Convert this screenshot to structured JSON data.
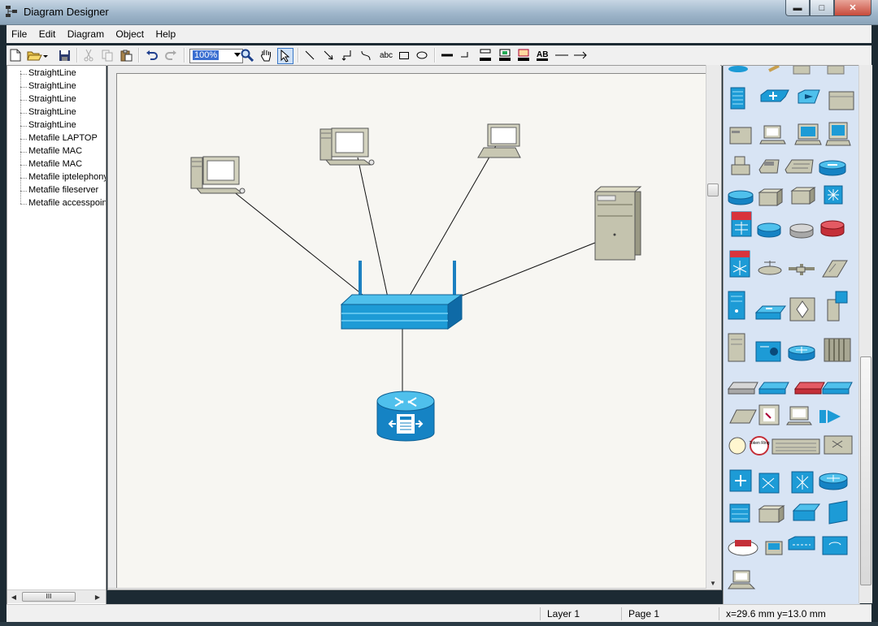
{
  "window": {
    "title": "Diagram Designer",
    "minimize": "▬",
    "maximize": "□",
    "close": "✕"
  },
  "menu": [
    "File",
    "Edit",
    "Diagram",
    "Object",
    "Help"
  ],
  "toolbar": {
    "zoom_value": "100%",
    "text_tool_label": "abc"
  },
  "tree": {
    "items": [
      "StraightLine",
      "StraightLine",
      "StraightLine",
      "StraightLine",
      "StraightLine",
      "Metafile LAPTOP",
      "Metafile MAC",
      "Metafile MAC",
      "Metafile iptelephony",
      "Metafile fileserver",
      "Metafile accesspoint"
    ],
    "scroll_thumb_label": "III"
  },
  "palette": {
    "token_ring_label": "Token Ring"
  },
  "status": {
    "layer": "Layer 1",
    "page": "Page 1",
    "coords": "x=29.6 mm  y=13.0 mm"
  },
  "colors": {
    "canvas": "#f7f6f2",
    "palette_bg": "#d8e4f4",
    "network_blue": "#1d9bd6",
    "device_beige": "#c8c7b2"
  }
}
